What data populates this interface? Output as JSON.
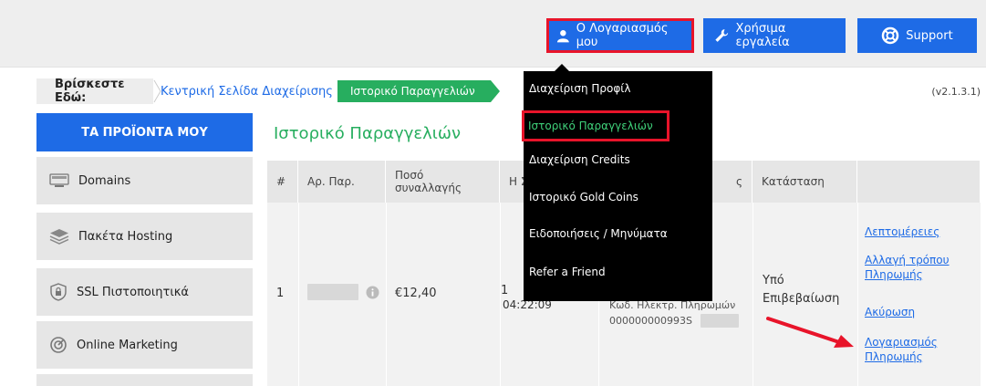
{
  "topbar": {
    "account_label": "Ο Λογαριασμός μου",
    "tools_label": "Χρήσιμα εργαλεία",
    "support_label": "Support"
  },
  "breadcrumb": {
    "here_label": "Βρίσκεστε Εδώ:",
    "home_label": "Κεντρική Σελίδα Διαχείρισης",
    "current_label": "Ιστορικό Παραγγελιών"
  },
  "version": "(v2.1.3.1)",
  "sidebar": {
    "header": "ΤΑ ΠΡΟΪΟΝΤΑ ΜΟΥ",
    "items": [
      {
        "label": "Domains",
        "icon": "domains-icon"
      },
      {
        "label": "Πακέτα Hosting",
        "icon": "layers-icon"
      },
      {
        "label": "SSL Πιστοποιητικά",
        "icon": "shield-lock-icon"
      },
      {
        "label": "Online Marketing",
        "icon": "target-icon"
      }
    ]
  },
  "main": {
    "title": "Ιστορικό Παραγγελιών",
    "table": {
      "headers": [
        "#",
        "Αρ. Παρ.",
        "Ποσό συναλλαγής",
        "Η Σ",
        "ς",
        "Κατάσταση",
        ""
      ],
      "row": {
        "index": "1",
        "amount": "€12,40",
        "date_frag_1": "1",
        "date_frag_2": "04:22:09",
        "payment_code_label": "Κωδ. Ηλεκτρ. Πληρωμών",
        "payment_code": "000000000993S",
        "status": "Υπό Επιβεβαίωση",
        "actions": [
          "Λεπτομέρειες",
          "Αλλαγή τρόπου Πληρωμής",
          "Ακύρωση",
          "Λογαριασμός Πληρωμής"
        ]
      }
    }
  },
  "dropdown": {
    "items": [
      "Διαχείριση Προφίλ",
      "Ιστορικό Παραγγελιών",
      "Διαχείριση Credits",
      "Ιστορικό Gold Coins",
      "Ειδοποιήσεις / Μηνύματα",
      "Refer a Friend"
    ]
  },
  "colors": {
    "primary_blue": "#1e6be6",
    "accent_green": "#27ae5f",
    "highlight_red": "#e8142a"
  }
}
